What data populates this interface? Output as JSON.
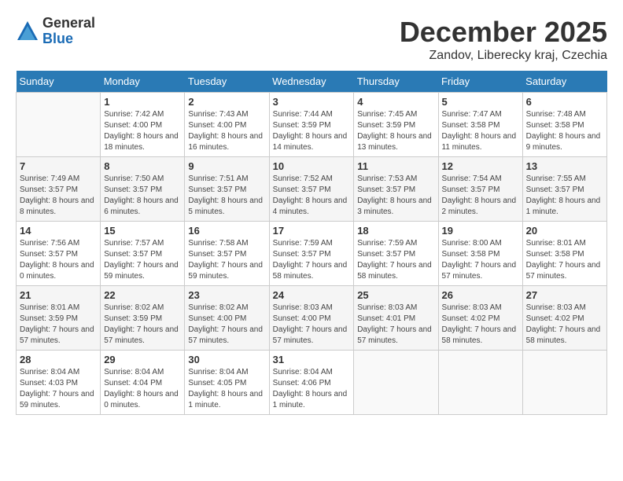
{
  "logo": {
    "general": "General",
    "blue": "Blue"
  },
  "title": "December 2025",
  "location": "Zandov, Liberecky kraj, Czechia",
  "days_of_week": [
    "Sunday",
    "Monday",
    "Tuesday",
    "Wednesday",
    "Thursday",
    "Friday",
    "Saturday"
  ],
  "weeks": [
    [
      {
        "day": "",
        "sunrise": "",
        "sunset": "",
        "daylight": ""
      },
      {
        "day": "1",
        "sunrise": "Sunrise: 7:42 AM",
        "sunset": "Sunset: 4:00 PM",
        "daylight": "Daylight: 8 hours and 18 minutes."
      },
      {
        "day": "2",
        "sunrise": "Sunrise: 7:43 AM",
        "sunset": "Sunset: 4:00 PM",
        "daylight": "Daylight: 8 hours and 16 minutes."
      },
      {
        "day": "3",
        "sunrise": "Sunrise: 7:44 AM",
        "sunset": "Sunset: 3:59 PM",
        "daylight": "Daylight: 8 hours and 14 minutes."
      },
      {
        "day": "4",
        "sunrise": "Sunrise: 7:45 AM",
        "sunset": "Sunset: 3:59 PM",
        "daylight": "Daylight: 8 hours and 13 minutes."
      },
      {
        "day": "5",
        "sunrise": "Sunrise: 7:47 AM",
        "sunset": "Sunset: 3:58 PM",
        "daylight": "Daylight: 8 hours and 11 minutes."
      },
      {
        "day": "6",
        "sunrise": "Sunrise: 7:48 AM",
        "sunset": "Sunset: 3:58 PM",
        "daylight": "Daylight: 8 hours and 9 minutes."
      }
    ],
    [
      {
        "day": "7",
        "sunrise": "Sunrise: 7:49 AM",
        "sunset": "Sunset: 3:57 PM",
        "daylight": "Daylight: 8 hours and 8 minutes."
      },
      {
        "day": "8",
        "sunrise": "Sunrise: 7:50 AM",
        "sunset": "Sunset: 3:57 PM",
        "daylight": "Daylight: 8 hours and 6 minutes."
      },
      {
        "day": "9",
        "sunrise": "Sunrise: 7:51 AM",
        "sunset": "Sunset: 3:57 PM",
        "daylight": "Daylight: 8 hours and 5 minutes."
      },
      {
        "day": "10",
        "sunrise": "Sunrise: 7:52 AM",
        "sunset": "Sunset: 3:57 PM",
        "daylight": "Daylight: 8 hours and 4 minutes."
      },
      {
        "day": "11",
        "sunrise": "Sunrise: 7:53 AM",
        "sunset": "Sunset: 3:57 PM",
        "daylight": "Daylight: 8 hours and 3 minutes."
      },
      {
        "day": "12",
        "sunrise": "Sunrise: 7:54 AM",
        "sunset": "Sunset: 3:57 PM",
        "daylight": "Daylight: 8 hours and 2 minutes."
      },
      {
        "day": "13",
        "sunrise": "Sunrise: 7:55 AM",
        "sunset": "Sunset: 3:57 PM",
        "daylight": "Daylight: 8 hours and 1 minute."
      }
    ],
    [
      {
        "day": "14",
        "sunrise": "Sunrise: 7:56 AM",
        "sunset": "Sunset: 3:57 PM",
        "daylight": "Daylight: 8 hours and 0 minutes."
      },
      {
        "day": "15",
        "sunrise": "Sunrise: 7:57 AM",
        "sunset": "Sunset: 3:57 PM",
        "daylight": "Daylight: 7 hours and 59 minutes."
      },
      {
        "day": "16",
        "sunrise": "Sunrise: 7:58 AM",
        "sunset": "Sunset: 3:57 PM",
        "daylight": "Daylight: 7 hours and 59 minutes."
      },
      {
        "day": "17",
        "sunrise": "Sunrise: 7:59 AM",
        "sunset": "Sunset: 3:57 PM",
        "daylight": "Daylight: 7 hours and 58 minutes."
      },
      {
        "day": "18",
        "sunrise": "Sunrise: 7:59 AM",
        "sunset": "Sunset: 3:57 PM",
        "daylight": "Daylight: 7 hours and 58 minutes."
      },
      {
        "day": "19",
        "sunrise": "Sunrise: 8:00 AM",
        "sunset": "Sunset: 3:58 PM",
        "daylight": "Daylight: 7 hours and 57 minutes."
      },
      {
        "day": "20",
        "sunrise": "Sunrise: 8:01 AM",
        "sunset": "Sunset: 3:58 PM",
        "daylight": "Daylight: 7 hours and 57 minutes."
      }
    ],
    [
      {
        "day": "21",
        "sunrise": "Sunrise: 8:01 AM",
        "sunset": "Sunset: 3:59 PM",
        "daylight": "Daylight: 7 hours and 57 minutes."
      },
      {
        "day": "22",
        "sunrise": "Sunrise: 8:02 AM",
        "sunset": "Sunset: 3:59 PM",
        "daylight": "Daylight: 7 hours and 57 minutes."
      },
      {
        "day": "23",
        "sunrise": "Sunrise: 8:02 AM",
        "sunset": "Sunset: 4:00 PM",
        "daylight": "Daylight: 7 hours and 57 minutes."
      },
      {
        "day": "24",
        "sunrise": "Sunrise: 8:03 AM",
        "sunset": "Sunset: 4:00 PM",
        "daylight": "Daylight: 7 hours and 57 minutes."
      },
      {
        "day": "25",
        "sunrise": "Sunrise: 8:03 AM",
        "sunset": "Sunset: 4:01 PM",
        "daylight": "Daylight: 7 hours and 57 minutes."
      },
      {
        "day": "26",
        "sunrise": "Sunrise: 8:03 AM",
        "sunset": "Sunset: 4:02 PM",
        "daylight": "Daylight: 7 hours and 58 minutes."
      },
      {
        "day": "27",
        "sunrise": "Sunrise: 8:03 AM",
        "sunset": "Sunset: 4:02 PM",
        "daylight": "Daylight: 7 hours and 58 minutes."
      }
    ],
    [
      {
        "day": "28",
        "sunrise": "Sunrise: 8:04 AM",
        "sunset": "Sunset: 4:03 PM",
        "daylight": "Daylight: 7 hours and 59 minutes."
      },
      {
        "day": "29",
        "sunrise": "Sunrise: 8:04 AM",
        "sunset": "Sunset: 4:04 PM",
        "daylight": "Daylight: 8 hours and 0 minutes."
      },
      {
        "day": "30",
        "sunrise": "Sunrise: 8:04 AM",
        "sunset": "Sunset: 4:05 PM",
        "daylight": "Daylight: 8 hours and 1 minute."
      },
      {
        "day": "31",
        "sunrise": "Sunrise: 8:04 AM",
        "sunset": "Sunset: 4:06 PM",
        "daylight": "Daylight: 8 hours and 1 minute."
      },
      {
        "day": "",
        "sunrise": "",
        "sunset": "",
        "daylight": ""
      },
      {
        "day": "",
        "sunrise": "",
        "sunset": "",
        "daylight": ""
      },
      {
        "day": "",
        "sunrise": "",
        "sunset": "",
        "daylight": ""
      }
    ]
  ]
}
